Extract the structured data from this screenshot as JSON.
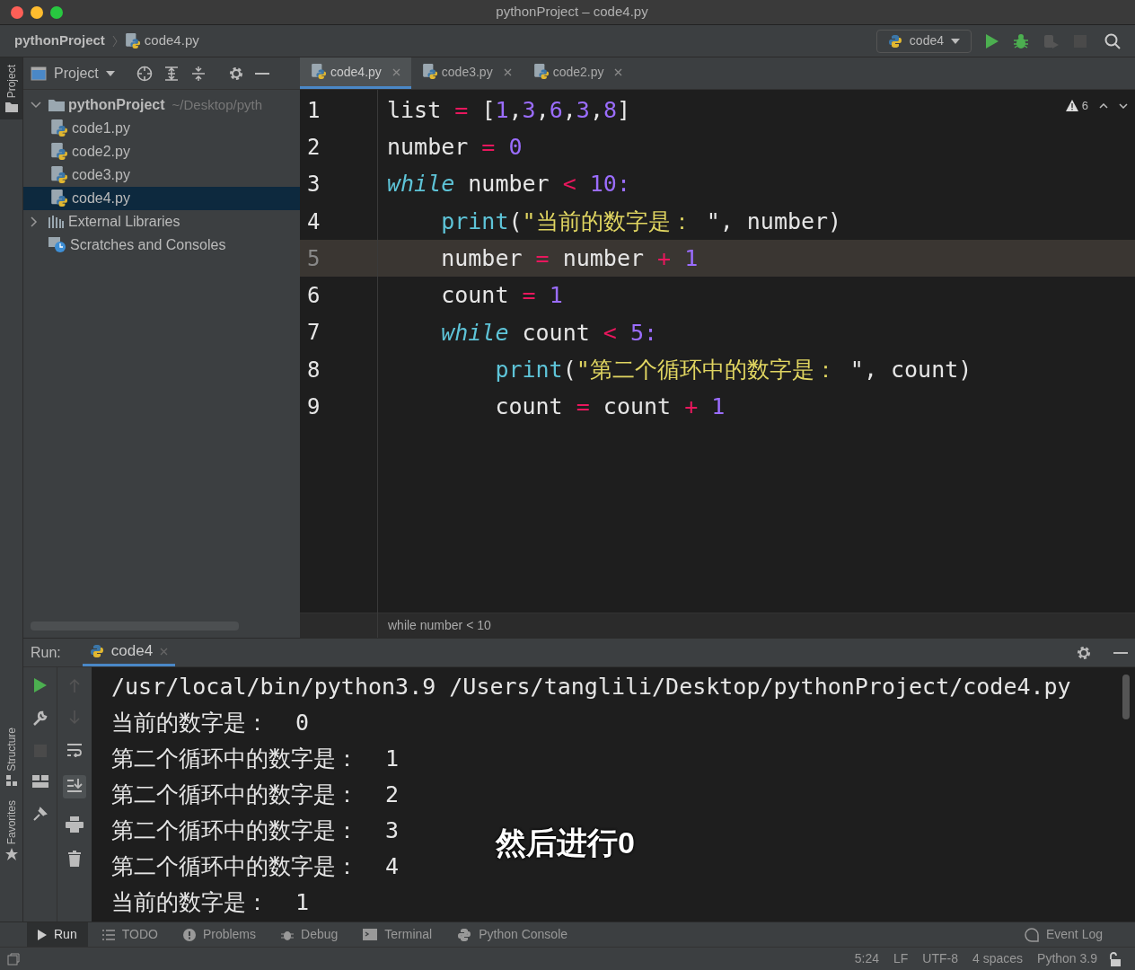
{
  "window": {
    "title": "pythonProject – code4.py"
  },
  "nav": {
    "crumbs": [
      "pythonProject",
      "code4.py"
    ],
    "run_config": "code4"
  },
  "project_panel": {
    "title": "Project",
    "tree": [
      {
        "label": "pythonProject",
        "path": "~/Desktop/pyth",
        "kind": "folder",
        "expanded": true,
        "selected": false,
        "children": [
          {
            "label": "code1.py",
            "kind": "py",
            "selected": false
          },
          {
            "label": "code2.py",
            "kind": "py",
            "selected": false
          },
          {
            "label": "code3.py",
            "kind": "py",
            "selected": false
          },
          {
            "label": "code4.py",
            "kind": "py",
            "selected": true
          }
        ]
      },
      {
        "label": "External Libraries",
        "kind": "lib",
        "expanded": false,
        "selected": false
      },
      {
        "label": "Scratches and Consoles",
        "kind": "scratch",
        "selected": false
      }
    ]
  },
  "left_stripe": [
    "Project",
    "Structure",
    "Favorites"
  ],
  "editor_tabs": [
    {
      "label": "code4.py",
      "selected": true
    },
    {
      "label": "code3.py",
      "selected": false
    },
    {
      "label": "code2.py",
      "selected": false
    }
  ],
  "warnings": "6",
  "code_lines": [
    {
      "number": "1",
      "current": false,
      "tokens": [
        {
          "kind": "plain",
          "text": "list "
        },
        {
          "kind": "op",
          "text": "="
        },
        {
          "kind": "plain",
          "text": " ["
        },
        {
          "kind": "num",
          "text": "1"
        },
        {
          "kind": "plain",
          "text": ","
        },
        {
          "kind": "num",
          "text": "3"
        },
        {
          "kind": "plain",
          "text": ","
        },
        {
          "kind": "num",
          "text": "6"
        },
        {
          "kind": "plain",
          "text": ","
        },
        {
          "kind": "num",
          "text": "3"
        },
        {
          "kind": "plain",
          "text": ","
        },
        {
          "kind": "num",
          "text": "8"
        },
        {
          "kind": "plain",
          "text": "]"
        }
      ]
    },
    {
      "number": "2",
      "current": false,
      "tokens": [
        {
          "kind": "plain",
          "text": "number "
        },
        {
          "kind": "op",
          "text": "= "
        },
        {
          "kind": "num",
          "text": "0"
        }
      ]
    },
    {
      "number": "3",
      "current": false,
      "tokens": [
        {
          "kind": "kw",
          "text": "while"
        },
        {
          "kind": "plain",
          "text": " number "
        },
        {
          "kind": "op",
          "text": "< "
        },
        {
          "kind": "num",
          "text": "10:"
        }
      ]
    },
    {
      "number": "4",
      "current": false,
      "tokens": [
        {
          "kind": "fn",
          "text": "    print"
        },
        {
          "kind": "plain",
          "text": "("
        },
        {
          "kind": "str",
          "text": "\"当前的数字是："
        },
        {
          "kind": "plain",
          "text": " \", number)"
        }
      ]
    },
    {
      "number": "5",
      "current": true,
      "tokens": [
        {
          "kind": "plain",
          "text": "    number "
        },
        {
          "kind": "op",
          "text": "="
        },
        {
          "kind": "plain",
          "text": " number "
        },
        {
          "kind": "op",
          "text": "+ "
        },
        {
          "kind": "num",
          "text": "1"
        }
      ]
    },
    {
      "number": "6",
      "current": false,
      "tokens": [
        {
          "kind": "plain",
          "text": "    count "
        },
        {
          "kind": "op",
          "text": "= "
        },
        {
          "kind": "num",
          "text": "1"
        }
      ]
    },
    {
      "number": "7",
      "current": false,
      "tokens": [
        {
          "kind": "kw",
          "text": "    while"
        },
        {
          "kind": "plain",
          "text": " count "
        },
        {
          "kind": "op",
          "text": "< "
        },
        {
          "kind": "num",
          "text": "5:"
        }
      ]
    },
    {
      "number": "8",
      "current": false,
      "tokens": [
        {
          "kind": "fn",
          "text": "        print"
        },
        {
          "kind": "plain",
          "text": "("
        },
        {
          "kind": "str",
          "text": "\"第二个循环中的数字是："
        },
        {
          "kind": "plain",
          "text": " \", count)"
        }
      ]
    },
    {
      "number": "9",
      "current": false,
      "tokens": [
        {
          "kind": "plain",
          "text": "        count "
        },
        {
          "kind": "op",
          "text": "="
        },
        {
          "kind": "plain",
          "text": " count "
        },
        {
          "kind": "op",
          "text": "+ "
        },
        {
          "kind": "num",
          "text": "1"
        }
      ]
    }
  ],
  "breadcrumb": "while number < 10",
  "run_panel": {
    "label": "Run:",
    "tab": "code4",
    "output": [
      "/usr/local/bin/python3.9 /Users/tanglili/Desktop/pythonProject/code4.py",
      "当前的数字是：  0",
      "第二个循环中的数字是：  1",
      "第二个循环中的数字是：  2",
      "第二个循环中的数字是：  3",
      "第二个循环中的数字是：  4",
      "当前的数字是：  1"
    ]
  },
  "subtitle": "然后进行0",
  "tool_windows": [
    {
      "label": "Run",
      "kind": "run",
      "selected": true
    },
    {
      "label": "TODO",
      "kind": "todo",
      "selected": false
    },
    {
      "label": "Problems",
      "kind": "problems",
      "selected": false
    },
    {
      "label": "Debug",
      "kind": "debug",
      "selected": false
    },
    {
      "label": "Terminal",
      "kind": "terminal",
      "selected": false
    },
    {
      "label": "Python Console",
      "kind": "console",
      "selected": false
    }
  ],
  "event_log": "Event Log",
  "status_bar": [
    "5:24",
    "LF",
    "UTF-8",
    "4 spaces",
    "Python 3.9"
  ]
}
